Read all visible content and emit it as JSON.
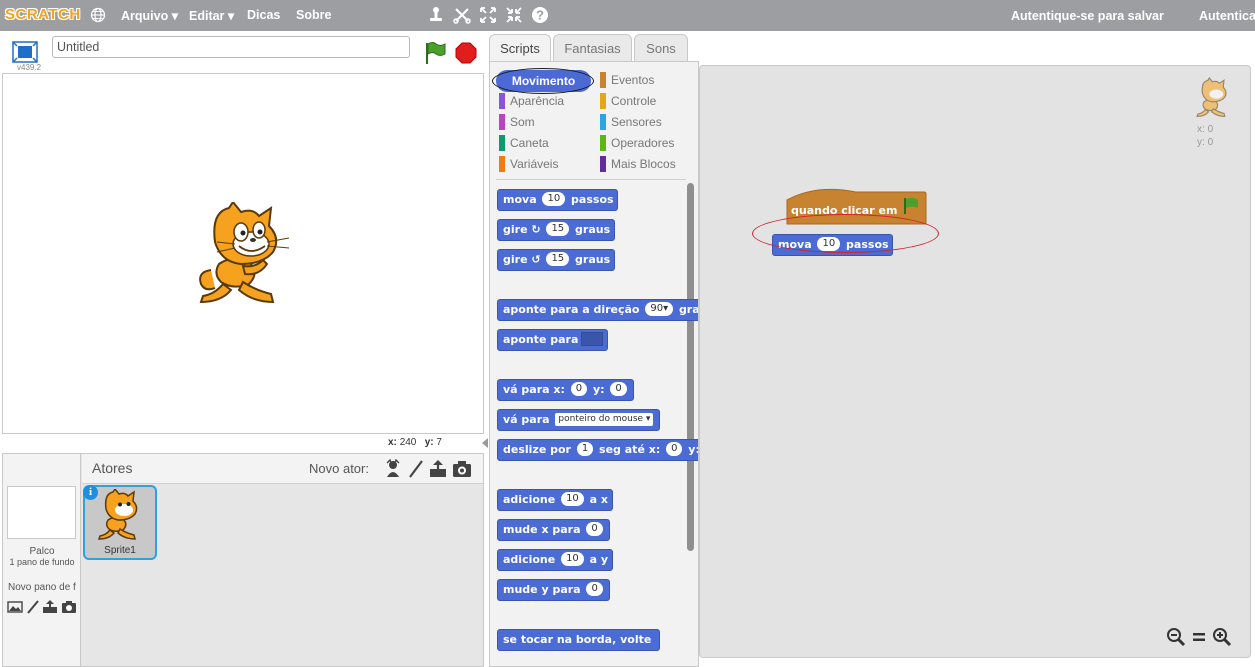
{
  "topbar": {
    "logo": "SCRATCH",
    "menus": [
      "Arquivo",
      "Editar",
      "Dicas",
      "Sobre"
    ],
    "save_hint": "Autentique-se para salvar",
    "login": "Autenticar"
  },
  "stage": {
    "version": "v439.2",
    "project_title": "Untitled",
    "mouse_x_label": "x:",
    "mouse_x": "240",
    "mouse_y_label": "y:",
    "mouse_y": "7"
  },
  "sprites": {
    "header": "Atores",
    "new_sprite": "Novo ator:",
    "stage_label": "Palco",
    "stage_backdrops": "1 pano de fundo",
    "new_backdrop": "Novo pano de f",
    "sprite1": "Sprite1",
    "info_glyph": "i"
  },
  "tabs": [
    "Scripts",
    "Fantasias",
    "Sons"
  ],
  "categories": {
    "selected": "Movimento",
    "left": [
      {
        "label": "Aparência",
        "color": "#8a55d7"
      },
      {
        "label": "Som",
        "color": "#bb42c3"
      },
      {
        "label": "Caneta",
        "color": "#0e9a6c"
      },
      {
        "label": "Variáveis",
        "color": "#ee7d16"
      }
    ],
    "right": [
      {
        "label": "Eventos",
        "color": "#c88330"
      },
      {
        "label": "Controle",
        "color": "#e1a91a"
      },
      {
        "label": "Sensores",
        "color": "#2ca5e2"
      },
      {
        "label": "Operadores",
        "color": "#5cb712"
      },
      {
        "label": "Mais Blocos",
        "color": "#632d99"
      }
    ]
  },
  "blocks": {
    "move": {
      "a": "mova",
      "n": "10",
      "b": "passos"
    },
    "turn_right": {
      "a": "gire",
      "n": "15",
      "b": "graus"
    },
    "turn_left": {
      "a": "gire",
      "n": "15",
      "b": "graus"
    },
    "point_dir": {
      "a": "aponte para a direção",
      "n": "90▾",
      "b": "gra"
    },
    "point_to": {
      "a": "aponte para"
    },
    "goto_xy": {
      "a": "vá para x:",
      "x": "0",
      "b": "y:",
      "y": "0"
    },
    "goto": {
      "a": "vá para",
      "d": "ponteiro do mouse ▾"
    },
    "glide": {
      "a": "deslize por",
      "n": "1",
      "b": "seg até x:",
      "x": "0",
      "c": "y:"
    },
    "change_x": {
      "a": "adicione",
      "n": "10",
      "b": "a x"
    },
    "set_x": {
      "a": "mude x para",
      "n": "0"
    },
    "change_y": {
      "a": "adicione",
      "n": "10",
      "b": "a y"
    },
    "set_y": {
      "a": "mude y para",
      "n": "0"
    },
    "bounce": {
      "a": "se tocar na borda, volte"
    }
  },
  "script": {
    "hat": "quando clicar em",
    "move": {
      "a": "mova",
      "n": "10",
      "b": "passos"
    }
  },
  "sprite_info": {
    "x_label": "x:",
    "x": "0",
    "y_label": "y:",
    "y": "0"
  },
  "colors": {
    "motion": "#4a6cd4",
    "events": "#c88330",
    "selected_ring": "#1a1a1a",
    "highlight_ring": "#d6202a"
  }
}
